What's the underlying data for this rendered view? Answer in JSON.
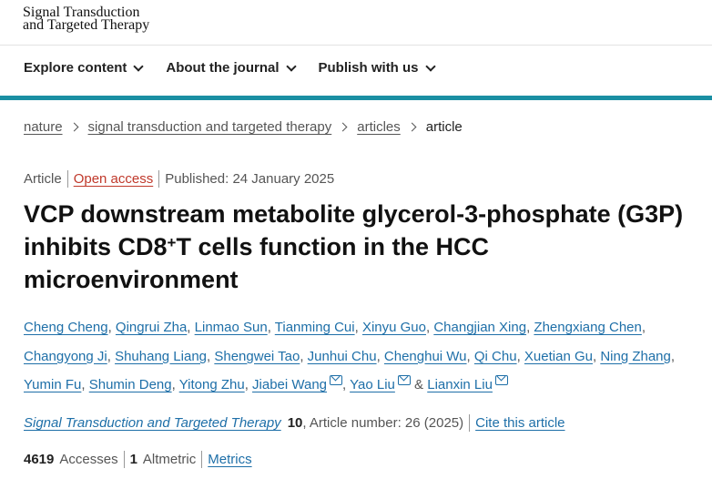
{
  "journal_logo": {
    "line1": "Signal Transduction",
    "line2": "and Targeted Therapy"
  },
  "nav": [
    {
      "label": "Explore content"
    },
    {
      "label": "About the journal"
    },
    {
      "label": "Publish with us"
    }
  ],
  "breadcrumbs": {
    "items": [
      "nature",
      "signal transduction and targeted therapy",
      "articles"
    ],
    "current": "article"
  },
  "meta": {
    "type": "Article",
    "access": "Open access",
    "published": "Published: 24 January 2025"
  },
  "article": {
    "title_part1": "VCP downstream metabolite glycerol-3-phosphate (G3P) inhibits CD8",
    "title_sup": "+",
    "title_part2": "T cells function in the HCC microenvironment"
  },
  "authors": [
    "Cheng Cheng",
    "Qingrui Zha",
    "Linmao Sun",
    "Tianming Cui",
    "Xinyu Guo",
    "Changjian Xing",
    "Zhengxiang Chen",
    "Changyong Ji",
    "Shuhang Liang",
    "Shengwei Tao",
    "Junhui Chu",
    "Chenghui Wu",
    "Qi Chu",
    "Xuetian Gu",
    "Ning Zhang",
    "Yumin Fu",
    "Shumin Deng",
    "Yitong Zhu",
    "Jiabei Wang",
    "Yao Liu",
    "Lianxin Liu"
  ],
  "authors_ampersand": "&",
  "citation": {
    "journal": "Signal Transduction and Targeted Therapy",
    "volume": "10",
    "article_number": ", Article number: 26 (2025)",
    "cite_label": "Cite this article"
  },
  "metrics": {
    "accesses_count": "4619",
    "accesses_label": "Accesses",
    "altmetric_count": "1",
    "altmetric_label": "Altmetric",
    "metrics_link": "Metrics"
  },
  "colors": {
    "accent_bar": "#1a8fa3",
    "link": "#1e6fa8",
    "open_access": "#c0392b"
  }
}
